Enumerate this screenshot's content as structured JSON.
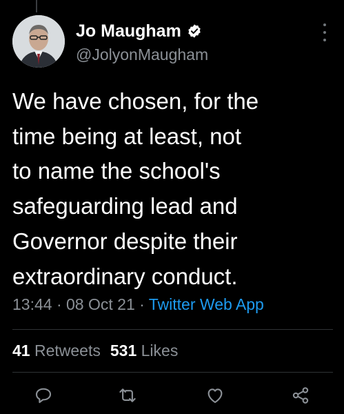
{
  "author": {
    "display_name": "Jo Maugham",
    "handle": "@JolyonMaugham",
    "verified_icon": "verified-badge-icon"
  },
  "tweet": {
    "lines": [
      "We have chosen, for the",
      "time being at least, not",
      "to name the school's",
      "safeguarding lead and",
      "Governor despite their",
      "extraordinary conduct."
    ]
  },
  "meta": {
    "time": "13:44",
    "sep1": " · ",
    "date": "08 Oct 21",
    "sep2": " · ",
    "source": "Twitter Web App"
  },
  "stats": {
    "retweets_count": "41",
    "retweets_label": "Retweets",
    "likes_count": "531",
    "likes_label": "Likes"
  },
  "actions": [
    "reply-icon",
    "retweet-icon",
    "like-icon",
    "share-icon"
  ],
  "colors": {
    "background": "#000000",
    "text": "#ffffff",
    "secondary": "#8b9096",
    "link": "#1d9bf0",
    "divider": "#2f3336"
  }
}
